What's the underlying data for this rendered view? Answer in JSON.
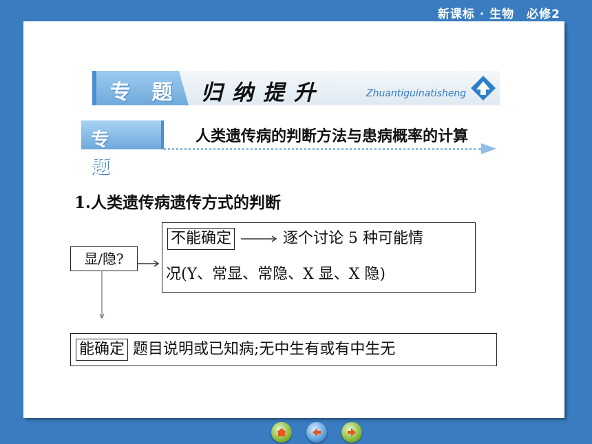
{
  "header": {
    "tag": "新课标 · 生物　必修2"
  },
  "banner": {
    "tag": "专 题",
    "title": "归纳提升",
    "pinyin": "Zhuantiguinatisheng"
  },
  "topic": {
    "tag": "专 题",
    "title": "人类遗传病的判断方法与患病概率的计算"
  },
  "section": {
    "heading": "1.人类遗传病遗传方式的判断"
  },
  "flow": {
    "start_box": "显/隐?",
    "uncertain_label": "不能确定",
    "uncertain_text_1": "逐个讨论 5 种可能情",
    "uncertain_text_2": "况(Y、常显、常隐、X 显、X 隐)",
    "certain_label": "能确定",
    "certain_text": "题目说明或已知病;无中生有或有中生无"
  },
  "nav": {
    "items": [
      "home-icon",
      "back-icon",
      "next-icon"
    ]
  }
}
